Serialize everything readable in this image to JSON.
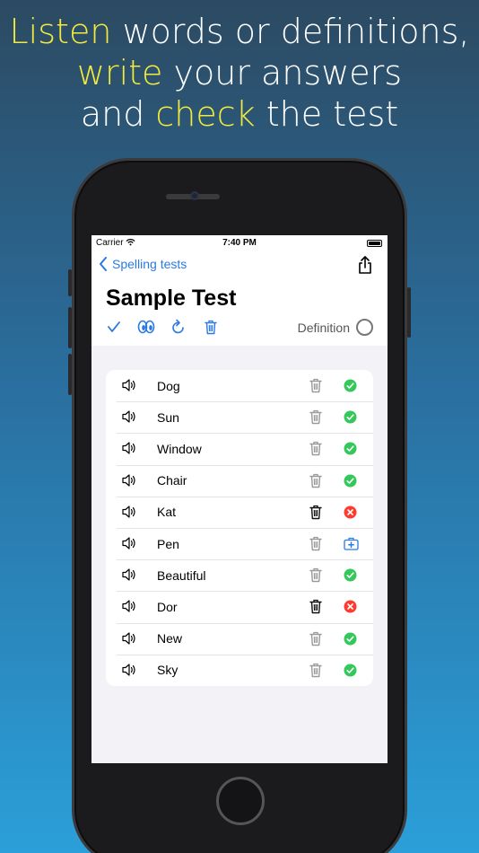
{
  "headline": {
    "line1": {
      "hl": "Listen",
      "rest": " words or definitions,"
    },
    "line2": {
      "hl": "write",
      "rest": " your answers"
    },
    "line3": {
      "pre": "and ",
      "hl": "check",
      "rest": " the test"
    }
  },
  "status_bar": {
    "carrier": "Carrier",
    "time": "7:40 PM"
  },
  "nav": {
    "back_label": "Spelling tests"
  },
  "title": "Sample Test",
  "toolbar": {
    "definition_label": "Definition"
  },
  "words": [
    {
      "word": "Dog",
      "result": "correct",
      "trash_active": false
    },
    {
      "word": "Sun",
      "result": "correct",
      "trash_active": false
    },
    {
      "word": "Window",
      "result": "correct",
      "trash_active": false
    },
    {
      "word": "Chair",
      "result": "correct",
      "trash_active": false
    },
    {
      "word": "Kat",
      "result": "wrong",
      "trash_active": true
    },
    {
      "word": "Pen",
      "result": "add",
      "trash_active": false
    },
    {
      "word": "Beautiful",
      "result": "correct",
      "trash_active": false
    },
    {
      "word": "Dor",
      "result": "wrong",
      "trash_active": true
    },
    {
      "word": "New",
      "result": "correct",
      "trash_active": false
    },
    {
      "word": "Sky",
      "result": "correct",
      "trash_active": false
    }
  ],
  "colors": {
    "accent": "#2a7ae2",
    "highlight": "#f2ea3c",
    "correct": "#34c759",
    "wrong": "#ff3b30"
  }
}
